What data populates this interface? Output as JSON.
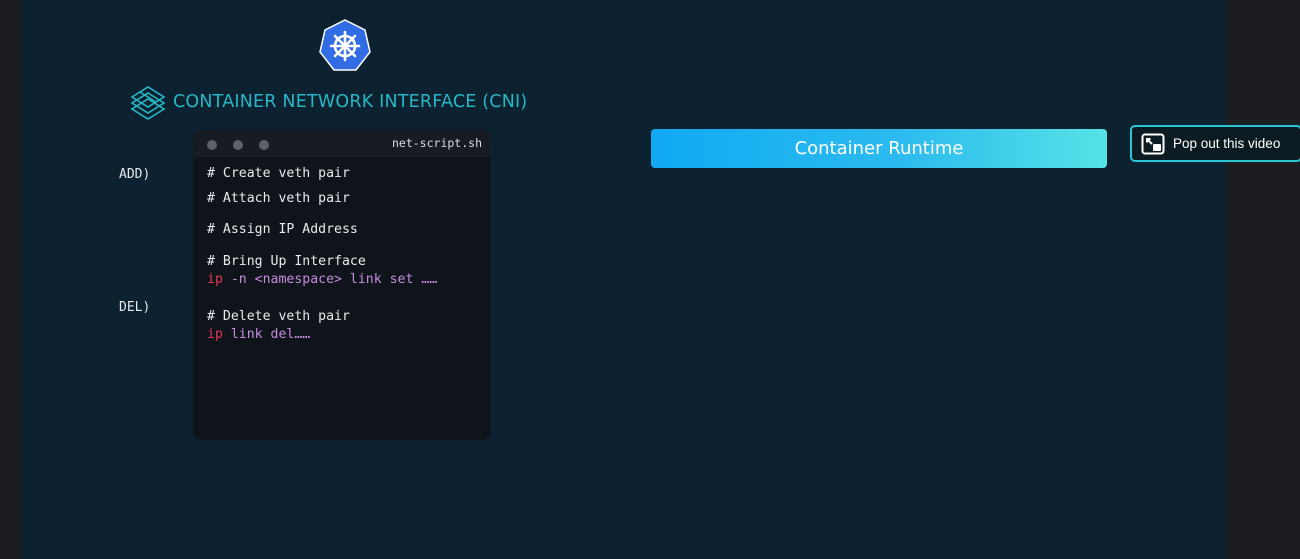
{
  "slide": {
    "cni_title": "CONTAINER NETWORK INTERFACE (CNI)",
    "labels": {
      "add": "ADD)",
      "del": "DEL)"
    },
    "terminal": {
      "title": "net-script.sh",
      "lines": {
        "c1": "# Create veth pair",
        "c2": "# Attach veth pair",
        "c3": "# Assign IP Address",
        "c4": "# Bring Up Interface",
        "cmd1_kw": "ip",
        "cmd1_rest": " -n <namespace> link set ……",
        "c5": "# Delete veth pair",
        "cmd2_kw": "ip",
        "cmd2_rest": " link del……"
      }
    },
    "runtime_button": "Container Runtime"
  },
  "overlay": {
    "popout_label": "Pop out this video"
  },
  "colors": {
    "stage_bg": "#0d2230",
    "cni_teal": "#27b6c5",
    "k8s_blue": "#326ce5",
    "keyword_red": "#e8385a",
    "arg_purple": "#c98be0"
  },
  "icons": {
    "k8s": "kubernetes-helm-icon",
    "cni": "cni-layers-icon",
    "popout": "picture-in-picture-icon"
  }
}
